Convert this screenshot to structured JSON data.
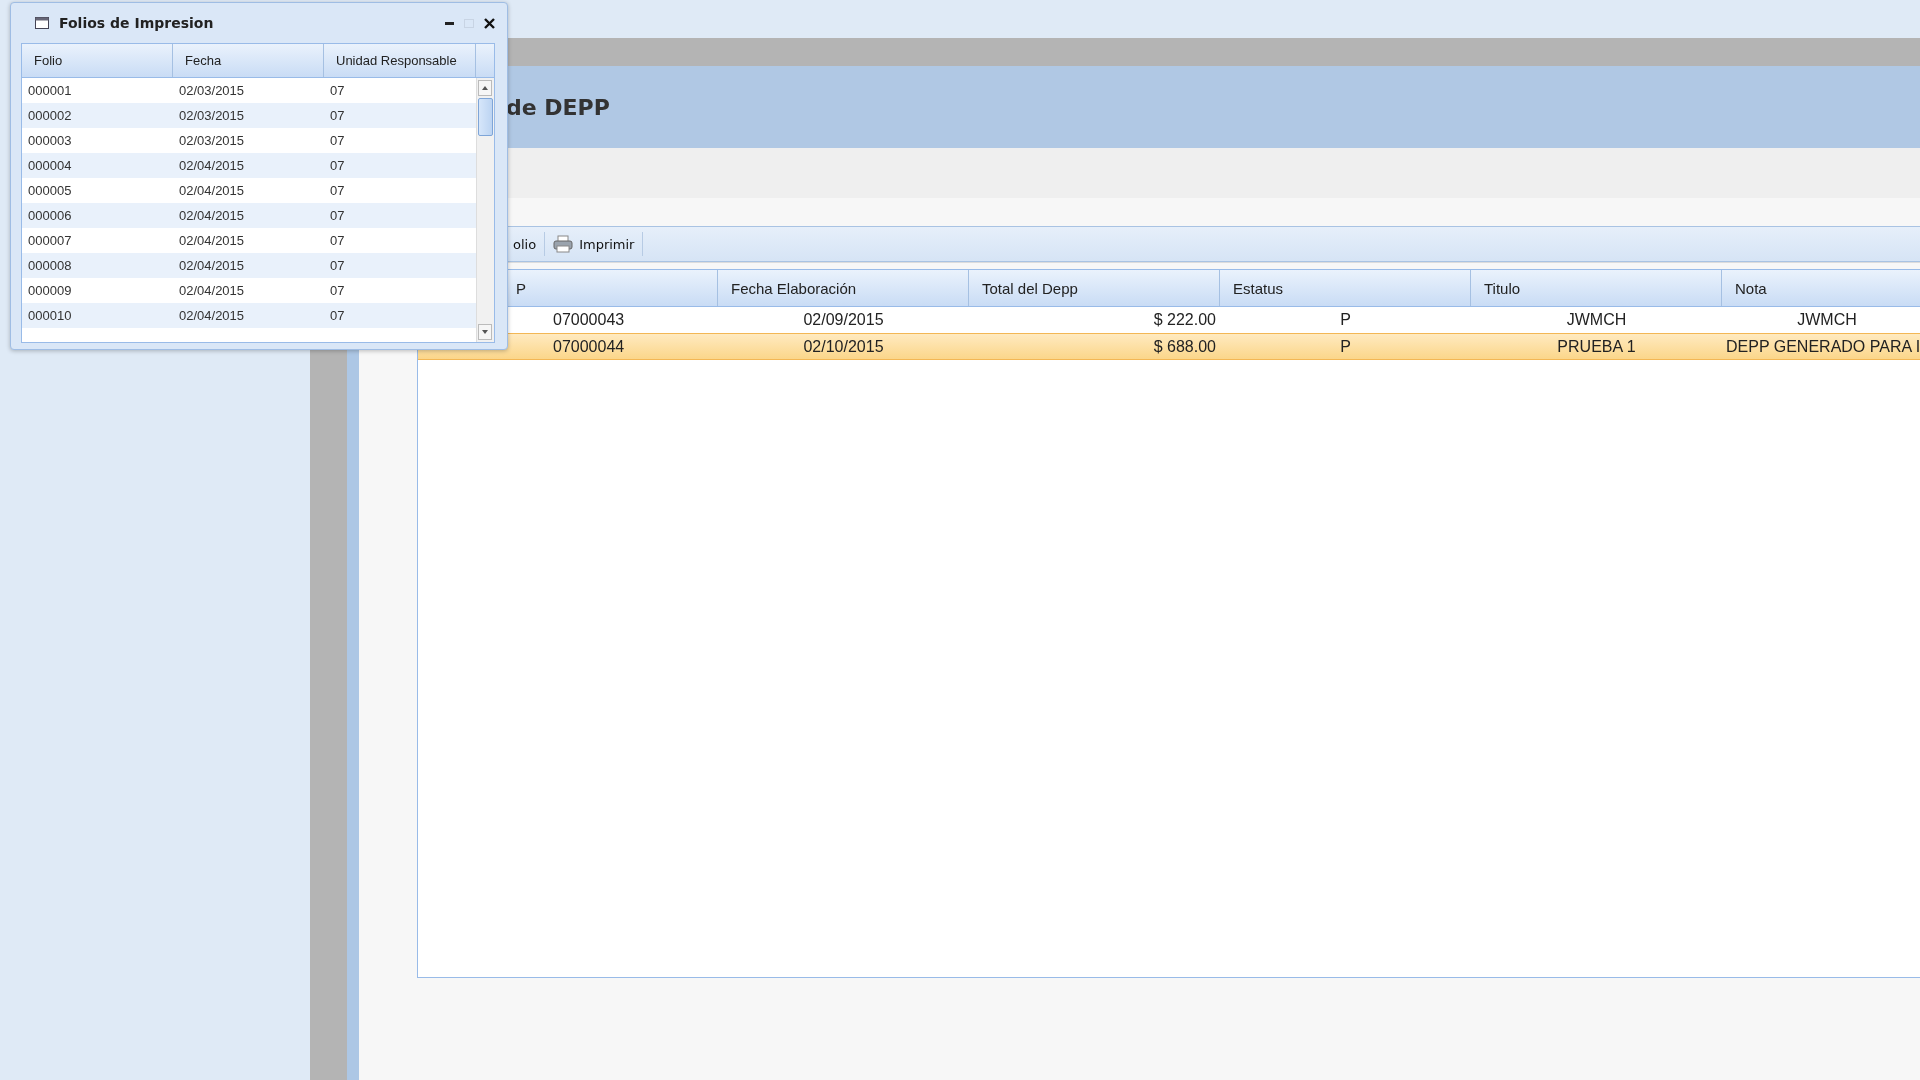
{
  "page": {
    "title": "de DEPP",
    "toolbar": [
      {
        "label": "olio"
      },
      {
        "label": "Imprimir"
      }
    ],
    "grid": {
      "columns": [
        "P",
        "Fecha Elaboración",
        "Total del Depp",
        "Estatus",
        "Titulo",
        "Nota"
      ],
      "rows": [
        {
          "cells": [
            "07000043",
            "02/09/2015",
            "$ 222.00",
            "P",
            "JWMCH",
            "JWMCH"
          ],
          "selected": false
        },
        {
          "cells": [
            "07000044",
            "02/10/2015",
            "$ 688.00",
            "P",
            "PRUEBA 1",
            "DEPP GENERADO PARA I"
          ],
          "selected": true
        }
      ]
    }
  },
  "dialog": {
    "title": "Folios de Impresion",
    "columns": [
      "Folio",
      "Fecha",
      "Unidad Responsable"
    ],
    "rows": [
      [
        "000001",
        "02/03/2015",
        "07"
      ],
      [
        "000002",
        "02/03/2015",
        "07"
      ],
      [
        "000003",
        "02/03/2015",
        "07"
      ],
      [
        "000004",
        "02/04/2015",
        "07"
      ],
      [
        "000005",
        "02/04/2015",
        "07"
      ],
      [
        "000006",
        "02/04/2015",
        "07"
      ],
      [
        "000007",
        "02/04/2015",
        "07"
      ],
      [
        "000008",
        "02/04/2015",
        "07"
      ],
      [
        "000009",
        "02/04/2015",
        "07"
      ],
      [
        "000010",
        "02/04/2015",
        "07"
      ]
    ]
  }
}
